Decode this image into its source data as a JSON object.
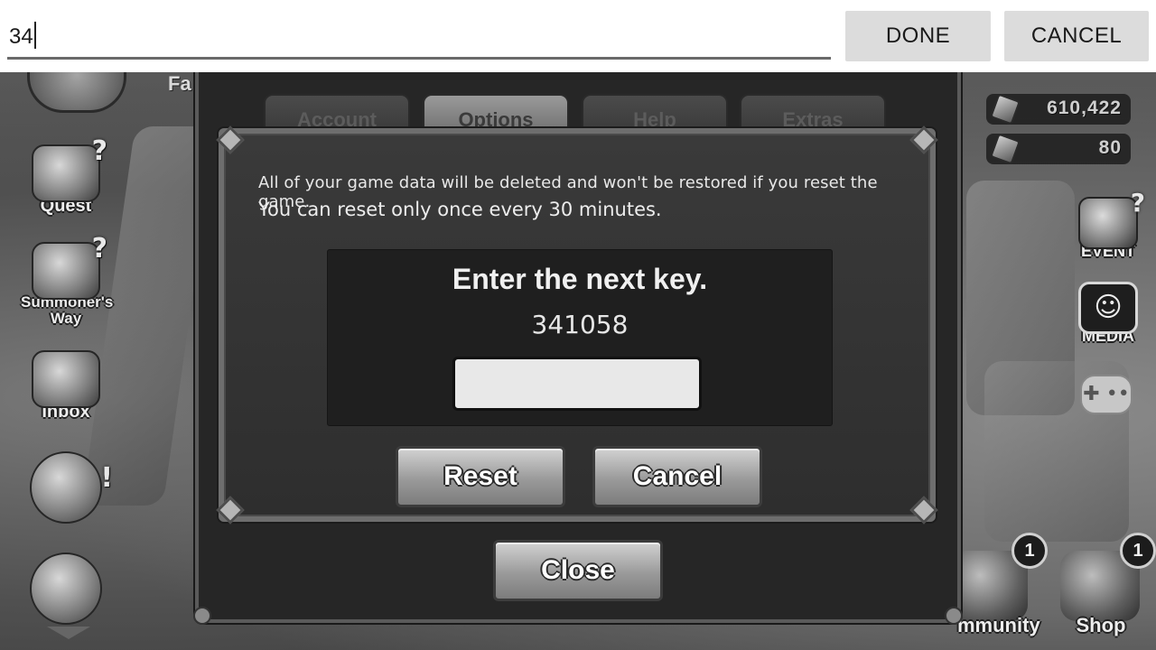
{
  "ime": {
    "input_value": "34",
    "done_label": "DONE",
    "cancel_label": "CANCEL"
  },
  "sidebar_left": {
    "top_partial_label": "Fa",
    "items": [
      {
        "label": "Quest",
        "icon": "quest-scroll-icon"
      },
      {
        "label": "Summoner's Way",
        "icon": "summoners-way-icon"
      },
      {
        "label": "Inbox",
        "icon": "inbox-chest-icon"
      },
      {
        "label": "",
        "icon": "pack-bundle-icon"
      },
      {
        "label": "",
        "icon": "chest-shop-icon"
      }
    ]
  },
  "resources": [
    {
      "value": "610,422",
      "icon": "crystal-icon"
    },
    {
      "value": "80",
      "icon": "gem-icon"
    }
  ],
  "sidebar_right": {
    "event_label": "EVENT",
    "media_label": "MEDIA",
    "controller_icon": "gamepad-icon"
  },
  "bottom_right": [
    {
      "label": "mmunity",
      "badge": "1"
    },
    {
      "label": "Shop",
      "badge": "1"
    }
  ],
  "settings": {
    "tabs": [
      {
        "label": "Account",
        "active": false
      },
      {
        "label": "Options",
        "active": true
      },
      {
        "label": "Help",
        "active": false
      },
      {
        "label": "Extras",
        "active": false
      }
    ],
    "close_label": "Close"
  },
  "reset_dialog": {
    "message_line1": "All of your game data will be deleted and won't be restored if you reset the game.",
    "message_line2": "You can reset only once every 30 minutes.",
    "key_title": "Enter the next key.",
    "key_code": "341058",
    "key_input_value": "",
    "reset_label": "Reset",
    "cancel_label": "Cancel"
  }
}
